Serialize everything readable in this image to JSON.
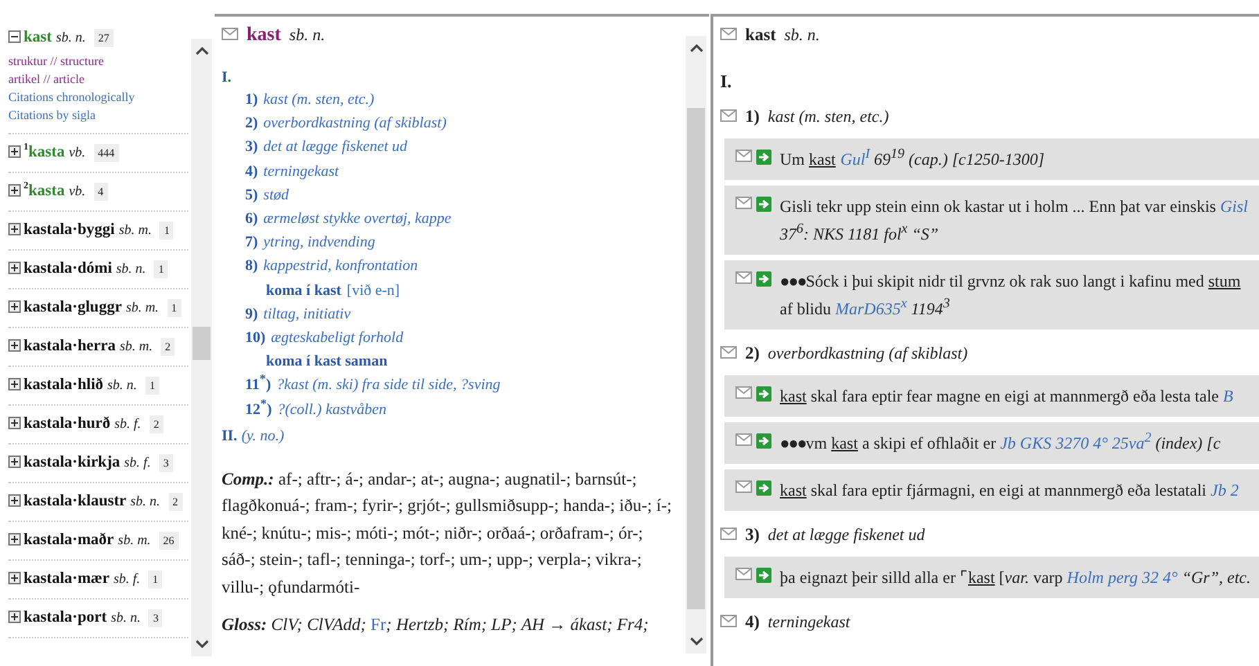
{
  "sidebar": {
    "entries": [
      {
        "kind": "simplex",
        "headword": "kast",
        "pos": "sb. n.",
        "count": "27",
        "expanded": true,
        "links": [
          {
            "text": "struktur // structure",
            "kind": "view"
          },
          {
            "text": "artikel // article",
            "kind": "view"
          },
          {
            "text": "Citations chronologically",
            "kind": "citations"
          },
          {
            "text": "Citations by sigla",
            "kind": "citations"
          }
        ]
      },
      {
        "kind": "simplex",
        "homograph": "1",
        "headword": "kasta",
        "pos": "vb.",
        "count": "444",
        "expanded": false
      },
      {
        "kind": "simplex",
        "homograph": "2",
        "headword": "kasta",
        "pos": "vb.",
        "count": "4",
        "expanded": false
      },
      {
        "kind": "compound",
        "headword": "kastala·byggi",
        "pos": "sb. m.",
        "count": "1",
        "expanded": false
      },
      {
        "kind": "compound",
        "headword": "kastala·dómi",
        "pos": "sb. n.",
        "count": "1",
        "expanded": false
      },
      {
        "kind": "compound",
        "headword": "kastala·gluggr",
        "pos": "sb. m.",
        "count": "1",
        "expanded": false
      },
      {
        "kind": "compound",
        "headword": "kastala·herra",
        "pos": "sb. m.",
        "count": "2",
        "expanded": false
      },
      {
        "kind": "compound",
        "headword": "kastala·hlið",
        "pos": "sb. n.",
        "count": "1",
        "expanded": false
      },
      {
        "kind": "compound",
        "headword": "kastala·hurð",
        "pos": "sb. f.",
        "count": "2",
        "expanded": false
      },
      {
        "kind": "compound",
        "headword": "kastala·kirkja",
        "pos": "sb. f.",
        "count": "3",
        "expanded": false
      },
      {
        "kind": "compound",
        "headword": "kastala·klaustr",
        "pos": "sb. n.",
        "count": "2",
        "expanded": false
      },
      {
        "kind": "compound",
        "headword": "kastala·maðr",
        "pos": "sb. m.",
        "count": "26",
        "expanded": false
      },
      {
        "kind": "compound",
        "headword": "kastala·mær",
        "pos": "sb. f.",
        "count": "1",
        "expanded": false
      },
      {
        "kind": "compound",
        "headword": "kastala·port",
        "pos": "sb. n.",
        "count": "3",
        "expanded": false
      }
    ]
  },
  "article": {
    "headword": "kast",
    "pos": "sb. n.",
    "sections": [
      {
        "numeral": "I.",
        "senses": [
          {
            "kind": "sense",
            "num": "1)",
            "gloss": "kast (m. sten, etc.)"
          },
          {
            "kind": "sense",
            "num": "2)",
            "gloss": "overbordkastning (af skiblast)"
          },
          {
            "kind": "sense",
            "num": "3)",
            "gloss": "det at lægge fiskenet ud"
          },
          {
            "kind": "sense",
            "num": "4)",
            "gloss": "terningekast"
          },
          {
            "kind": "sense",
            "num": "5)",
            "gloss": "stød"
          },
          {
            "kind": "sense",
            "num": "6)",
            "gloss": "ærmeløst stykke overtøj, kappe"
          },
          {
            "kind": "sense",
            "num": "7)",
            "gloss": "ytring, indvending"
          },
          {
            "kind": "sense",
            "num": "8)",
            "gloss": "kappestrid, konfrontation"
          },
          {
            "kind": "phrase",
            "phrase": "koma í kast",
            "note": "[við e-n]"
          },
          {
            "kind": "sense",
            "num": "9)",
            "gloss": "tiltag, initiativ"
          },
          {
            "kind": "sense",
            "num": "10)",
            "gloss": "ægteskabeligt forhold"
          },
          {
            "kind": "phrase",
            "phrase": "koma í kast saman"
          },
          {
            "kind": "sense",
            "num": "11$^{*}$)",
            "gloss": "?kast (m. ski) fra side til side, ?sving"
          },
          {
            "kind": "sense",
            "num": "12$^{*}$)",
            "gloss": "?(coll.) kastvåben"
          }
        ]
      },
      {
        "numeral": "II.",
        "gloss": "(y. no.)"
      }
    ],
    "comp": {
      "label": "Comp.:",
      "text": "af-; aftr-; á-; andar-; at-; augna-; augnatil-; barnsút-; flagðkonuá-; fram-; fyrir-; grjót-; gullsmiðsupp-; handa-; iðu-; í-; kné-; knútu-; mis-; móti-; mót-; niðr-; orðaá-; orðafram-; ór-; sáð-; stein-; tafl-; tenninga-; torf-; um-; upp-; verpla-; vikra-; villu-; ǫfundarmóti-"
    },
    "gloss": {
      "label": "Gloss:",
      "items": [
        {
          "text": "ClV; ClVAdd; ",
          "link": false
        },
        {
          "text": "Fr",
          "link": true
        },
        {
          "text": "; Hertzb; Rím; LP; AH → ákast; Fr4;",
          "link": false
        }
      ]
    }
  },
  "citations": {
    "headword": "kast",
    "pos": "sb. n.",
    "sections": [
      {
        "numeral": "I.",
        "senses": [
          {
            "num": "1)",
            "gloss": "kast (m. sten, etc.)",
            "citations": [
              {
                "segments": [
                  {
                    "kind": "text",
                    "t": "Um "
                  },
                  {
                    "kind": "word",
                    "t": "kast"
                  },
                  {
                    "kind": "source",
                    "t": "Gul$^{I}$"
                  },
                  {
                    "kind": "ref",
                    "t": " 69$^{19}$ (cap.) [c1250-1300]"
                  }
                ]
              },
              {
                "segments": [
                  {
                    "kind": "text",
                    "t": "Gisli tekr upp stein einn ok kastar ut i holm ... Enn þat var einskis "
                  },
                  {
                    "kind": "source",
                    "t": "Gisl"
                  },
                  {
                    "kind": "ref",
                    "t": " 37$^{6}$: NKS 1181 fol$^{x}$ “S”"
                  }
                ]
              },
              {
                "marker": "●●●",
                "segments": [
                  {
                    "kind": "text",
                    "t": "Sóck i þui skipit nidr til grvnz ok rak suo langt i kafinu med "
                  },
                  {
                    "kind": "word",
                    "t": "stum"
                  },
                  {
                    "kind": "text",
                    "t": " af blidu "
                  },
                  {
                    "kind": "source",
                    "t": "MarD635$^{x}$"
                  },
                  {
                    "kind": "ref",
                    "t": " 1194$^{3}$"
                  }
                ]
              }
            ]
          },
          {
            "num": "2)",
            "gloss": "overbordkastning (af skiblast)",
            "citations": [
              {
                "segments": [
                  {
                    "kind": "word",
                    "t": "kast"
                  },
                  {
                    "kind": "text",
                    "t": " skal fara eptir fear magne en eigi at mannmergð eða lesta tale "
                  },
                  {
                    "kind": "source",
                    "t": "B"
                  }
                ]
              },
              {
                "marker": "●●●",
                "segments": [
                  {
                    "kind": "text",
                    "t": "vm "
                  },
                  {
                    "kind": "word",
                    "t": "kast"
                  },
                  {
                    "kind": "text",
                    "t": " a skipi ef ofhlaðit er "
                  },
                  {
                    "kind": "source",
                    "t": "Jb GKS 3270 4° 25va$^{2}$"
                  },
                  {
                    "kind": "ref",
                    "t": " (index) [c"
                  }
                ]
              },
              {
                "segments": [
                  {
                    "kind": "word",
                    "t": "kast"
                  },
                  {
                    "kind": "text",
                    "t": " skal fara eptir fjármagni, en eigi at mannmergð eða lestatali "
                  },
                  {
                    "kind": "source",
                    "t": "Jb 2"
                  }
                ]
              }
            ]
          },
          {
            "num": "3)",
            "gloss": "det at lægge fiskenet ud",
            "citations": [
              {
                "segments": [
                  {
                    "kind": "text",
                    "t": "þa eignazt þeir silld alla er ⌜"
                  },
                  {
                    "kind": "word",
                    "t": "kast"
                  },
                  {
                    "kind": "text",
                    "t": " [*var.* varp "
                  },
                  {
                    "kind": "source",
                    "t": "Holm perg 32 4°"
                  },
                  {
                    "kind": "ref",
                    "t": " “Gr”, etc."
                  }
                ]
              }
            ]
          },
          {
            "num": "4)",
            "gloss": "terningekast"
          }
        ]
      }
    ]
  }
}
